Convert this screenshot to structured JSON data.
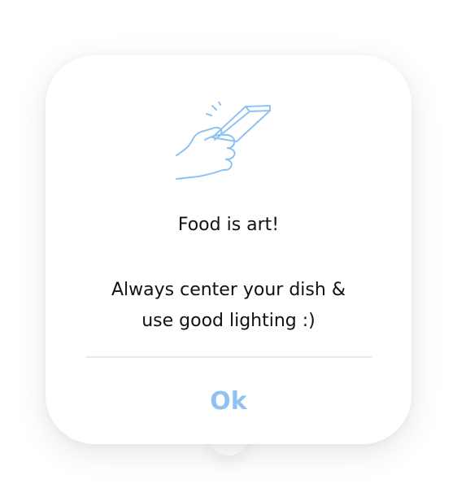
{
  "dialog": {
    "illustration_icon": "hand-holding-phone-icon",
    "title": "Food is art!",
    "message_line1": "Always center your dish &",
    "message_line2": "use good lighting :)",
    "ok_label": "Ok"
  },
  "colors": {
    "accent": "#8fc2f2",
    "text": "#111111",
    "divider": "#e9e9e9"
  }
}
